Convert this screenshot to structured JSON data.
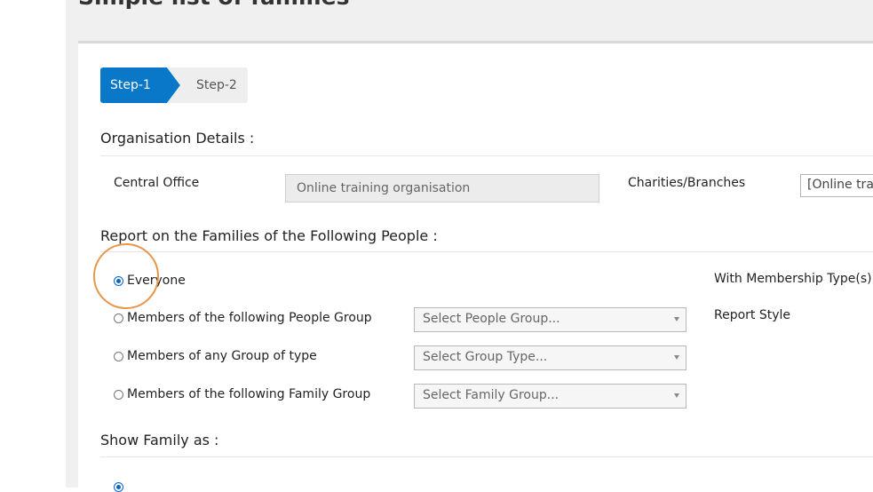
{
  "page": {
    "title": "Simple list of families"
  },
  "stepper": {
    "steps": [
      {
        "label": "Step-1"
      },
      {
        "label": "Step-2"
      }
    ]
  },
  "organisation": {
    "heading": "Organisation Details :",
    "central_office_label": "Central Office",
    "central_office_value": "Online training organisation",
    "branches_label": "Charities/Branches",
    "branches_value": "[Online trair"
  },
  "report_on": {
    "heading": "Report on the Families of the Following People :",
    "options": [
      {
        "label": "Everyone",
        "checked": true
      },
      {
        "label": "Members of the following People Group",
        "checked": false,
        "select_placeholder": "Select People Group..."
      },
      {
        "label": "Members of any Group of type",
        "checked": false,
        "select_placeholder": "Select Group Type..."
      },
      {
        "label": "Members of the following Family Group",
        "checked": false,
        "select_placeholder": "Select Family Group..."
      }
    ],
    "membership_types_label": "With Membership Type(s) :",
    "report_style_label": "Report Style"
  },
  "show_family": {
    "heading": "Show Family as :"
  },
  "colors": {
    "accent": "#0a78c8",
    "highlight": "#e8964a",
    "step_inactive": "#eeeeee",
    "readonly_bg": "#ececec",
    "content_bg": "#f0f0f0"
  },
  "icons": {
    "select_arrow": "caret-down-icon",
    "radio": "radio-icon"
  }
}
